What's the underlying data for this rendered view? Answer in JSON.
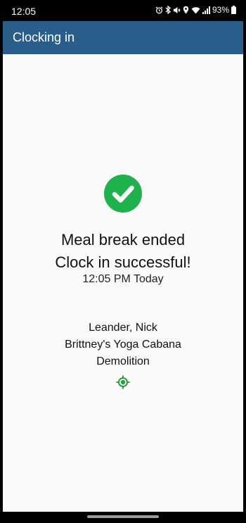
{
  "status_bar": {
    "time": "12:05",
    "battery_text": "93%",
    "icons": [
      "alarm-icon",
      "bluetooth-icon",
      "mute-icon",
      "location-icon",
      "wifi-icon",
      "signal-icon",
      "battery-icon"
    ]
  },
  "app_bar": {
    "title": "Clocking in",
    "color": "#295d8a"
  },
  "confirmation": {
    "icon": "check-circle-icon",
    "icon_color": "#1fb14b",
    "line1": "Meal break ended",
    "line2": "Clock in successful!",
    "timestamp": "12:05 PM Today"
  },
  "details": {
    "employee": "Leander, Nick",
    "location": "Brittney's Yoga Cabana",
    "job": "Demolition",
    "location_icon": "gps-target-icon",
    "location_icon_color": "#2e9e43"
  }
}
